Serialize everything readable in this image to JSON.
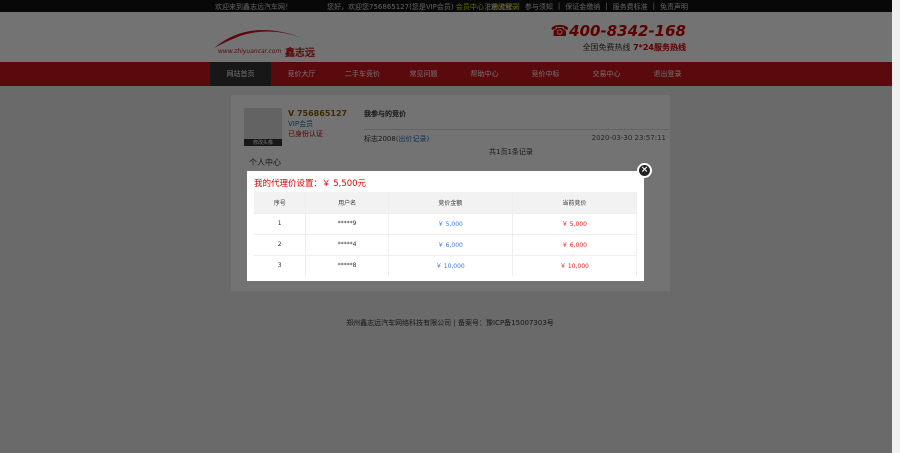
{
  "topbar": {
    "welcome": "欢迎来到鑫志远汽车网！",
    "greeting": "您好，欢迎您756865127(您是VIP会员)",
    "member_center": "会员中心",
    "logout": "退出登录",
    "links": [
      "注册流程",
      "参与须知",
      "保证金缴纳",
      "服务费标准",
      "免责声明"
    ]
  },
  "header": {
    "logo_url": "www.zhiyuancar.com",
    "logo_brand": "鑫志远",
    "phone": "400-8342-168",
    "phone_sub": "全国免费热线",
    "service": "7*24服务热线"
  },
  "nav": [
    "网站首页",
    "竞价大厅",
    "二手车竞价",
    "常见问题",
    "帮助中心",
    "竞价中标",
    "交易中心",
    "退出登录"
  ],
  "user": {
    "avatar_label": "修改头像",
    "id": "756865127",
    "level": "VIP会员",
    "auth": "已身份认证",
    "center": "个人中心"
  },
  "main": {
    "title": "我参与的竞价",
    "record_name": "标志2008",
    "record_link": "(出价记录)",
    "time": "2020-03-30 23:57:11",
    "pager": "共1页1条记录"
  },
  "footer": "郑州鑫志远汽车网络科技有限公司  |  备案号：豫ICP备15007303号",
  "modal": {
    "title": "我的代理价设置：￥ 5,500元",
    "headers": [
      "序号",
      "用户名",
      "竞价金额",
      "当前竞价"
    ],
    "rows": [
      [
        "1",
        "*****9",
        "￥ 5,000",
        "￥ 5,000"
      ],
      [
        "2",
        "*****4",
        "￥ 6,000",
        "￥ 6,000"
      ],
      [
        "3",
        "*****8",
        "￥ 10,000",
        "￥ 10,000"
      ]
    ]
  }
}
